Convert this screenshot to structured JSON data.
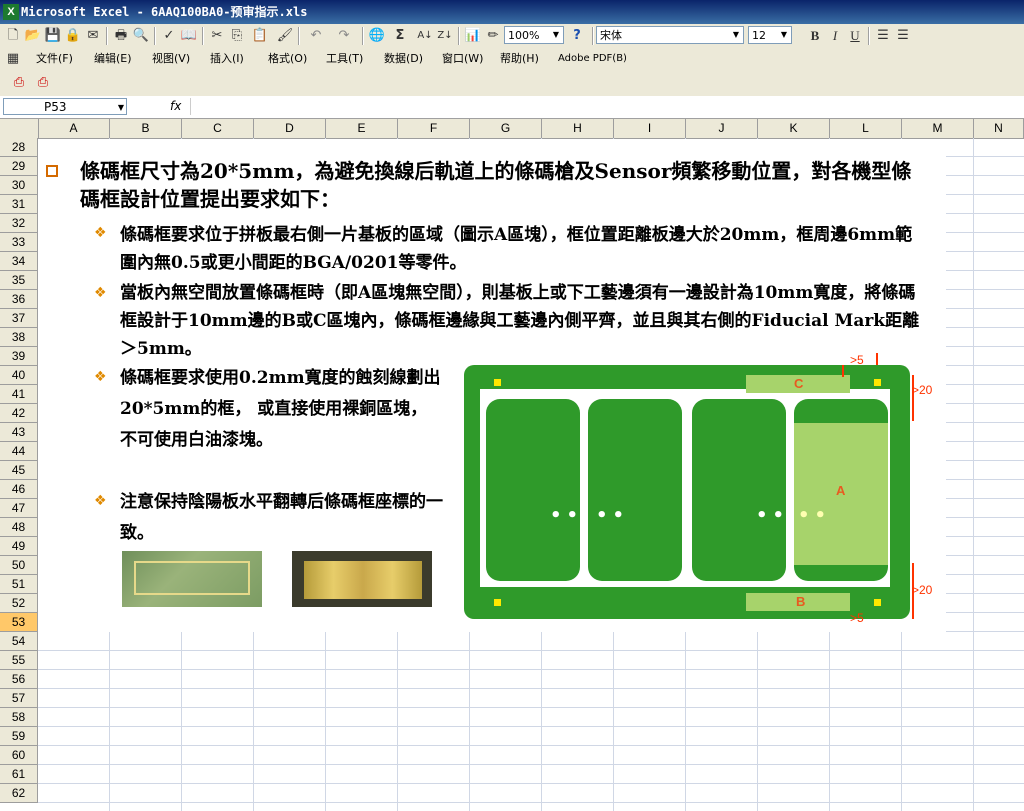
{
  "window": {
    "title": "Microsoft Excel - 6AAQ100BA0-预审指示.xls"
  },
  "toolbar": {
    "zoom": "100%",
    "font_name": "宋体",
    "font_size": "12",
    "bold": "B",
    "italic": "I",
    "underline": "U",
    "sum": "Σ",
    "help": "?"
  },
  "menu": [
    "文件(F)",
    "编辑(E)",
    "视图(V)",
    "插入(I)",
    "格式(O)",
    "工具(T)",
    "数据(D)",
    "窗口(W)",
    "帮助(H)",
    "Adobe PDF(B)"
  ],
  "formula_bar": {
    "name_box": "P53",
    "fx": "fx",
    "formula": ""
  },
  "columns": [
    "A",
    "B",
    "C",
    "D",
    "E",
    "F",
    "G",
    "H",
    "I",
    "J",
    "K",
    "L",
    "M",
    "N"
  ],
  "rows": [
    "28",
    "29",
    "30",
    "31",
    "32",
    "33",
    "34",
    "35",
    "36",
    "37",
    "38",
    "39",
    "40",
    "41",
    "42",
    "43",
    "44",
    "45",
    "46",
    "47",
    "48",
    "49",
    "50",
    "51",
    "52",
    "53",
    "54",
    "55",
    "56",
    "57",
    "58",
    "59",
    "60",
    "61",
    "62"
  ],
  "selected_row": "53",
  "slide": {
    "main_bullet": "條碼框尺寸為20*5mm，為避免換線后軌道上的條碼槍及Sensor頻繁移動位置，對各機型條碼框設計位置提出要求如下：",
    "sub1": "條碼框要求位于拼板最右側一片基板的區域（圖示A區塊），框位置距離板邊大於20mm，框周邊6mm範圍內無0.5或更小間距的BGA/0201等零件。",
    "sub2": "當板內無空間放置條碼框時（即A區塊無空間），則基板上或下工藝邊須有一邊設計為10mm寬度，將條碼框設計于10mm邊的B或C區塊內，條碼框邊緣與工藝邊內側平齊，並且與其右側的Fiducial Mark距離＞5mm。",
    "sub3": "條碼框要求使用0.2mm寬度的蝕刻線劃出20*5mm的框， 或直接使用裸銅區塊， 不可使用白油漆塊。",
    "sub4": "注意保持陰陽板水平翻轉后條碼框座標的一致。",
    "diagram": {
      "label_a": "A",
      "label_b": "B",
      "label_c": "C",
      "dim_5_top": ">5",
      "dim_20_top": ">20",
      "dim_20_bottom": ">20",
      "dim_5_bottom": ">5"
    }
  }
}
